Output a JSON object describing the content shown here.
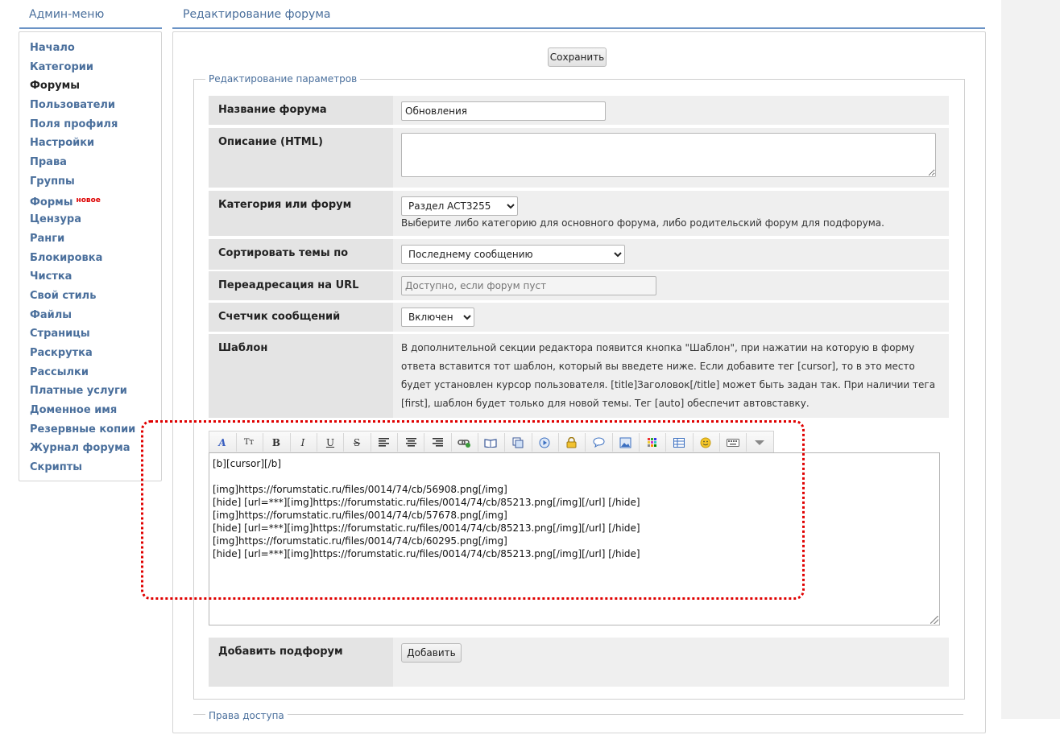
{
  "sidebar": {
    "title": "Админ-меню",
    "items": [
      {
        "label": "Начало"
      },
      {
        "label": "Категории"
      },
      {
        "label": "Форумы",
        "active": true
      },
      {
        "label": "Пользователи"
      },
      {
        "label": "Поля профиля"
      },
      {
        "label": "Настройки"
      },
      {
        "label": "Права"
      },
      {
        "label": "Группы"
      },
      {
        "label": "Формы",
        "badge": "новое"
      },
      {
        "label": "Цензура"
      },
      {
        "label": "Ранги"
      },
      {
        "label": "Блокировка"
      },
      {
        "label": "Чистка"
      },
      {
        "label": "Свой стиль"
      },
      {
        "label": "Файлы"
      },
      {
        "label": "Страницы"
      },
      {
        "label": "Раскрутка"
      },
      {
        "label": "Рассылки"
      },
      {
        "label": "Платные услуги"
      },
      {
        "label": "Доменное имя"
      },
      {
        "label": "Резервные копии"
      },
      {
        "label": "Журнал форума"
      },
      {
        "label": "Скрипты"
      }
    ]
  },
  "main": {
    "title": "Редактирование форума",
    "save_label": "Сохранить",
    "params_legend": "Редактирование параметров",
    "access_legend": "Права доступа"
  },
  "form": {
    "name": {
      "label": "Название форума",
      "value": "Обновления"
    },
    "description": {
      "label": "Описание (HTML)",
      "value": ""
    },
    "category": {
      "label": "Категория или форум",
      "selected": "Раздел ACT3255",
      "hint": "Выберите либо категорию для основного форума, либо родительский форум для подфорума."
    },
    "sort": {
      "label": "Сортировать темы по",
      "selected": "Последнему сообщению"
    },
    "redirect": {
      "label": "Переадресация на URL",
      "placeholder": "Доступно, если форум пуст"
    },
    "counter": {
      "label": "Счетчик сообщений",
      "selected": "Включен"
    },
    "template": {
      "label": "Шаблон",
      "hint": "В дополнительной секции редактора появится кнопка \"Шаблон\", при нажатии на которую в форму ответа вставится тот шаблон, который вы введете ниже. Если добавите тег [cursor], то в это место будет установлен курсор пользователя. [title]Заголовок[/title] может быть задан так. При наличии тега [first], шаблон будет только для новой темы. Тег [auto] обеспечит автовставку."
    },
    "subforum": {
      "label": "Добавить подфорум",
      "button": "Добавить"
    }
  },
  "editor": {
    "content": "[b][cursor][/b]\n\n[img]https://forumstatic.ru/files/0014/74/cb/56908.png[/img]\n[hide] [url=***][img]https://forumstatic.ru/files/0014/74/cb/85213.png[/img][/url] [/hide]\n[img]https://forumstatic.ru/files/0014/74/cb/57678.png[/img]\n[hide] [url=***][img]https://forumstatic.ru/files/0014/74/cb/85213.png[/img][/url] [/hide]\n[img]https://forumstatic.ru/files/0014/74/cb/60295.png[/img]\n[hide] [url=***][img]https://forumstatic.ru/files/0014/74/cb/85213.png[/img][/url] [/hide]",
    "toolbar": [
      "font-icon",
      "size-icon",
      "bold-icon",
      "italic-icon",
      "underline-icon",
      "strike-icon",
      "align-left-icon",
      "align-center-icon",
      "align-right-icon",
      "link-icon",
      "book-icon",
      "copy-icon",
      "video-icon",
      "lock-icon",
      "quote-icon",
      "image-icon",
      "color-palette-icon",
      "table-icon",
      "smiley-icon",
      "keyboard-icon",
      "dropdown-icon"
    ]
  }
}
